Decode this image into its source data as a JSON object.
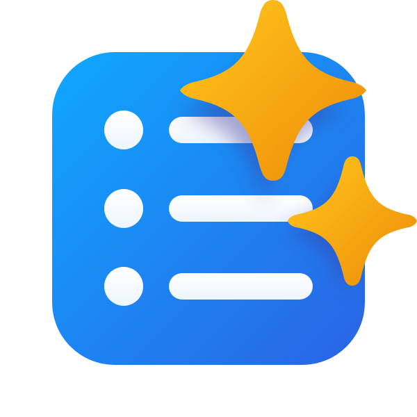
{
  "icon": {
    "name": "checklist-sparkle-app-icon",
    "colors": {
      "tile_top_left": "#0FA8FF",
      "tile_bottom_right": "#2A63E4",
      "list_item": "#EEF5FF",
      "sparkle_light": "#FFC81C",
      "sparkle_dark": "#EE8A08",
      "shadow": "#3B3A9E"
    },
    "list_rows": [
      {
        "bullet": "bullet-dot",
        "line": "list-line"
      },
      {
        "bullet": "bullet-dot",
        "line": "list-line"
      },
      {
        "bullet": "bullet-dot",
        "line": "list-line"
      }
    ],
    "sparkles": [
      {
        "name": "large-sparkle-icon"
      },
      {
        "name": "small-sparkle-icon"
      }
    ]
  }
}
